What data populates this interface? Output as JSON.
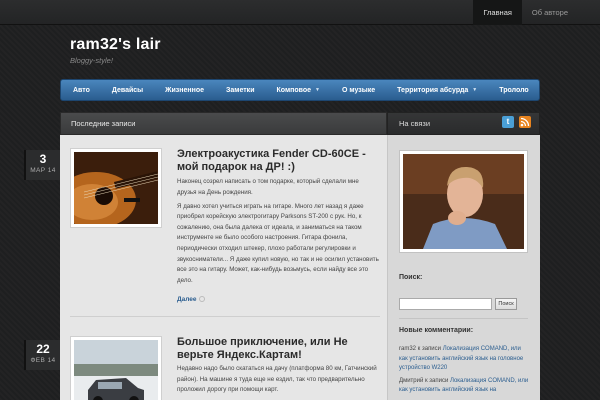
{
  "topnav": {
    "items": [
      "Главная",
      "Об авторе"
    ]
  },
  "site": {
    "title": "ram32's lair",
    "description": "Bloggy-style!"
  },
  "mainnav": {
    "items": [
      {
        "label": "Авто",
        "dropdown": false
      },
      {
        "label": "Девайсы",
        "dropdown": false
      },
      {
        "label": "Жизненное",
        "dropdown": false
      },
      {
        "label": "Заметки",
        "dropdown": false
      },
      {
        "label": "Комповое",
        "dropdown": true
      },
      {
        "label": "О музыке",
        "dropdown": false
      },
      {
        "label": "Территория абсурда",
        "dropdown": true
      },
      {
        "label": "Трололо",
        "dropdown": false
      }
    ]
  },
  "content": {
    "header": "Последние записи"
  },
  "sidebar": {
    "header": "На связи",
    "search_title": "Поиск:",
    "search_button": "Поиск",
    "comments_title": "Новые комментарии:",
    "comments": [
      {
        "author": "ram32",
        "connector": " к записи ",
        "link": "Локализация COMAND, или как установить английский язык на головное устройство W220"
      },
      {
        "author": "Дмитрий",
        "connector": " к записи ",
        "link": "Локализация COMAND, или как установить английский язык на"
      }
    ]
  },
  "posts": [
    {
      "day": "3",
      "month": "МАР 14",
      "title": "Электроакустика Fender CD-60CE - мой подарок на ДР! :)",
      "paragraphs": [
        "Наконец созрел написать о том подарке, который сделали мне друзья на День рождения.",
        "Я давно хотел учиться играть на гитаре. Много лет назад я даже приобрел корейскую электрогитару Parksons ST-200 с рук. Но, к сожалению, она была далека от идеала, и заниматься на таком инструменте не было особого настроения. Гитара фонила, периодически отходил штекер, плохо работали регулировки и звукосниматели... Я даже купил новую, но так и не осилил установить все это на гитару. Может, как-нибудь возьмусь, если найду все это дело."
      ],
      "more": "Далее"
    },
    {
      "day": "22",
      "month": "ФЕВ 14",
      "title": "Большое приключение, или Не верьте Яндекс.Картам!",
      "paragraphs": [
        "Недавно надо было скататься на дачу (платформа 80 км, Гатчинский район). На машине я туда еще не ездил, так что предварительно проложил дорогу при помощи карт."
      ]
    }
  ],
  "colors": {
    "nav": "#3a72a8",
    "link": "#2a5d8f",
    "rss": "#e8841f",
    "twitter": "#4a9fd6"
  }
}
